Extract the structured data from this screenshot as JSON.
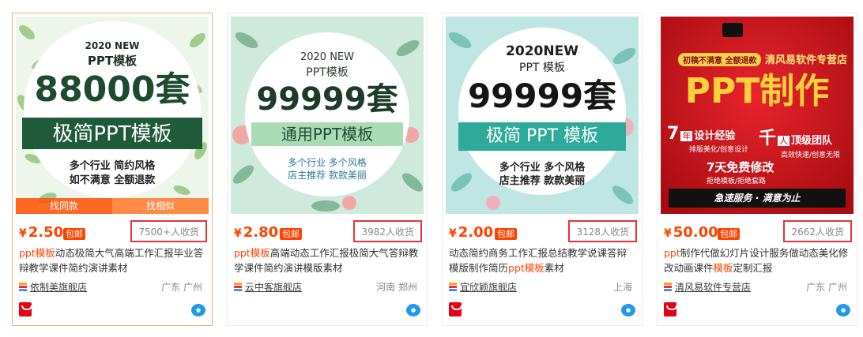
{
  "cards": [
    {
      "image": {
        "year": "2020 NEW",
        "sub": "PPT模板",
        "big": "88000套",
        "band": "极简PPT模板",
        "line1": "多个行业  简约风格",
        "line2": "如不满意  全额退款",
        "theme": "leaf-dark-green"
      },
      "overlay": {
        "left": "找同款",
        "right": "找相似"
      },
      "price": "2.50",
      "currency": "¥",
      "badge": "包邮",
      "sold": "7500+人收货",
      "title_kw": "ppt模板",
      "title_rest": "动态极简大气高端工作汇报毕业答辩教学课件简约演讲素材",
      "shop": "依制美旗舰店",
      "location": "广东 广州"
    },
    {
      "image": {
        "year": "2020 NEW",
        "sub": "PPT模板",
        "big": "99999套",
        "band": "通用PPT模板",
        "line1": "多个行业  多个风格",
        "line2": "店主推荐  款款美丽",
        "theme": "floral-mint"
      },
      "price": "2.80",
      "currency": "¥",
      "badge": "包邮",
      "sold": "3982人收货",
      "title_kw": "ppt模板",
      "title_rest": "高端动态工作汇报极简大气答辩教学课件简约演讲模版素材",
      "shop": "云中客旗舰店",
      "location": "河南 郑州"
    },
    {
      "image": {
        "year": "2020NEW",
        "sub": "PPT 模板",
        "big": "99999套",
        "band": "极简 PPT 模板",
        "line1": "多个行业  多个风格",
        "line2": "店主推荐  款款美丽",
        "theme": "floral-teal"
      },
      "price": "2.00",
      "currency": "¥",
      "badge": "包邮",
      "sold": "3128人收货",
      "title_pre": "动态简约商务工作汇报总结教学说课答辩模版制作简历",
      "title_kw": "ppt模板",
      "title_rest": "素材",
      "shop": "宜欣颖旗舰店",
      "location": "上海"
    },
    {
      "image": {
        "tag": "初稿不满意 全额退款",
        "store": "清风易软件专营店",
        "big": "PPT制作",
        "f1n": "7",
        "f1a": "年",
        "f1t": "设计经验",
        "f1s": "排版美化/创意设计",
        "f2n": "千",
        "f2a": "人",
        "f2t": "顶级团队",
        "f2s": "高效快速/创意无限",
        "f3t": "7天免费修改",
        "f3s": "拒绝模板/拒绝套路",
        "banner": "急速服务 · 满意为止",
        "theme": "red"
      },
      "price": "50.00",
      "currency": "¥",
      "badge": "包邮",
      "sold": "2662人收货",
      "title_kw1": "ppt",
      "title_mid": "制作代做幻灯片设计服务做动态美化修改动画课件",
      "title_kw2": "模板",
      "title_rest": "定制汇报",
      "shop": "清风易软件专营店",
      "location": "广东 广州"
    }
  ],
  "colors": {
    "price": "#ff4400",
    "highlight": "#e8313c",
    "tmall": "#e60012",
    "wangwang": "#1e9be8"
  },
  "icons": {
    "shop": "shop-stripes-icon",
    "tmall": "tmall-icon",
    "wangwang": "wangwang-chat-icon"
  }
}
